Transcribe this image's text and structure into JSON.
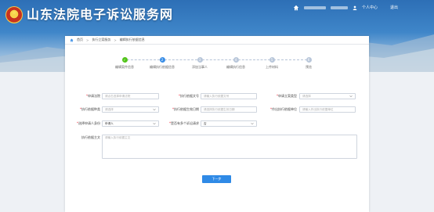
{
  "header": {
    "site_title": "山东法院电子诉讼服务网",
    "user_center": "个人中心",
    "logout": "退出"
  },
  "breadcrumb": {
    "items": [
      "首页",
      "执行立案服务",
      "编辑执行依据信息"
    ]
  },
  "steps": [
    {
      "label": "编辑案件信息",
      "state": "done"
    },
    {
      "label": "编辑执行依据信息",
      "state": "active",
      "num": "2"
    },
    {
      "label": "添加当事人",
      "state": "todo",
      "num": "3"
    },
    {
      "label": "编辑执行信息",
      "state": "todo",
      "num": "4"
    },
    {
      "label": "上传材料",
      "state": "todo",
      "num": "5"
    },
    {
      "label": "预览",
      "state": "todo",
      "num": "6"
    }
  ],
  "form": {
    "court": {
      "label": "申请法院",
      "placeholder": "请点击选择申请法院"
    },
    "case_no": {
      "label": "执行依据文号",
      "placeholder": "请输入执行依据文号"
    },
    "filing_type": {
      "label": "申请立案类型",
      "placeholder": "请选择"
    },
    "basis_type": {
      "label": "执行依据种类",
      "placeholder": "请选择"
    },
    "effective_date": {
      "label": "执行依据生效日期",
      "placeholder": "请选择执行依据生效日期"
    },
    "issuing_unit": {
      "label": "作出执行依据单位",
      "placeholder": "请输入作出执行依据单位"
    },
    "applicant_identity": {
      "label": "选择申请人身份",
      "value": "申请人"
    },
    "multi_request": {
      "label": "是否有多个诉讼请求",
      "value": "否"
    },
    "basis_text": {
      "label": "执行依据主文",
      "placeholder": "请输入执行依据主文"
    }
  },
  "next_button": "下一步",
  "colors": {
    "primary": "#2f8ae6",
    "done": "#52c41a",
    "header_blue": "#2d6fb6"
  }
}
